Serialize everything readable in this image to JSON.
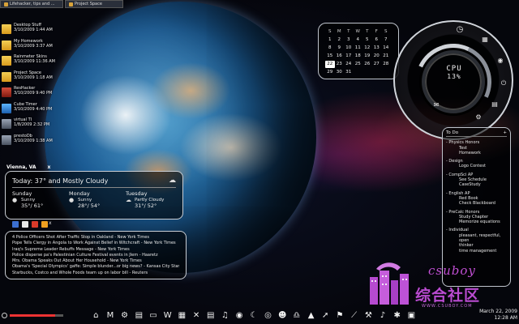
{
  "top_tabs": [
    {
      "label": "Lifehacker, tips and ..."
    },
    {
      "label": "Project Space"
    }
  ],
  "desktop_icons": [
    {
      "name": "Desktop Stuff",
      "date": "3/10/2009 1:44 AM",
      "type": "folder"
    },
    {
      "name": "My Homework",
      "date": "3/10/2009 3:37 AM",
      "type": "folder"
    },
    {
      "name": "Rainmeter Skins",
      "date": "3/10/2009 11:36 AM",
      "type": "folder"
    },
    {
      "name": "Project Space",
      "date": "3/10/2009 1:18 AM",
      "type": "folder"
    },
    {
      "name": "ResHacker",
      "date": "3/10/2009 9:40 PM",
      "type": "app"
    },
    {
      "name": "Cube Timer",
      "date": "3/10/2009 4:40 PM",
      "type": "app"
    },
    {
      "name": "virtual TI",
      "date": "1/8/2009 2:32 PM",
      "type": "app"
    },
    {
      "name": "prestoDb",
      "date": "3/10/2009 1:38 AM",
      "type": "app"
    }
  ],
  "calendar": {
    "days_of_week": [
      "S",
      "M",
      "T",
      "W",
      "T",
      "F",
      "S"
    ],
    "weeks": [
      [
        "1",
        "2",
        "3",
        "4",
        "5",
        "6",
        "7"
      ],
      [
        "8",
        "9",
        "10",
        "11",
        "12",
        "13",
        "14"
      ],
      [
        "15",
        "16",
        "17",
        "18",
        "19",
        "20",
        "21"
      ],
      [
        "22",
        "23",
        "24",
        "25",
        "26",
        "27",
        "28"
      ],
      [
        "29",
        "30",
        "31",
        "",
        "",
        "",
        ""
      ]
    ],
    "highlighted_day": "22"
  },
  "cpu": {
    "label": "CPU",
    "value": "13%"
  },
  "todo": {
    "title": "To Do",
    "add": "+",
    "groups": [
      {
        "title": "- Physics Honors",
        "items": [
          "Test",
          "Homework"
        ]
      },
      {
        "title": "- Design",
        "items": [
          "Logo Contest"
        ]
      },
      {
        "title": "- CompSci AP",
        "items": [
          "See Schedule",
          "CaseStudy"
        ]
      },
      {
        "title": "- English AP",
        "items": [
          "Red Book",
          "Check Blackboard"
        ]
      },
      {
        "title": "- PreCalc Honors",
        "items": [
          "Study Chapter",
          "Memorize equations"
        ]
      },
      {
        "title": "- Individual",
        "items": [
          "pleasant, respectful, open",
          "thinker",
          "time management"
        ]
      }
    ]
  },
  "weather": {
    "location": "Vienna, VA",
    "close": "x",
    "today": "Today:  37° and  Mostly Cloudy",
    "forecast": [
      {
        "day": "Sunday",
        "condition": "Sunny",
        "temps": "35°/ 61°",
        "icon": "sun-icon"
      },
      {
        "day": "Monday",
        "condition": "Sunny",
        "temps": "28°/ 54°",
        "icon": "sun-icon"
      },
      {
        "day": "Tuesday",
        "condition": "Partly Cloudy",
        "temps": "31°/ 52°",
        "icon": "cloud-icon"
      }
    ]
  },
  "news": {
    "close": "x",
    "headlines": [
      "4 Police Officers Shot After Traffic Stop in Oakland - New York Times",
      "Pope Tells Clergy in Angola to Work Against Belief in Witchcraft - New York Times",
      "Iraq's Supreme Leader Rebuffs Message - New York Times",
      "Police disperse pa's Palestinian Culture Festival events in Jlem - Haaretz",
      "Mrs. Obama Speaks Out About Her Household - New York Times",
      "Obama's 'Special Olympics' gaffe: Simple blunder...or big news? - Kansas City Star",
      "Starbucks, Costco and Whole Foods team up on labor bill - Reuters"
    ]
  },
  "watermark": {
    "brand": "csuboy",
    "chinese": "综合社区",
    "url": "WWW.CSUBOY.COM"
  },
  "clock": {
    "date": "March 22, 2009",
    "time": "12:28 AM"
  },
  "dock_icons": [
    "home",
    "M",
    "gear",
    "film",
    "folder",
    "W",
    "calc",
    "X",
    "doc",
    "music",
    "firefox",
    "moon",
    "chrome",
    "cat",
    "headphones",
    "cone",
    "cursor",
    "flag",
    "knife",
    "tool",
    "music-note",
    "gear2",
    "folder2"
  ]
}
